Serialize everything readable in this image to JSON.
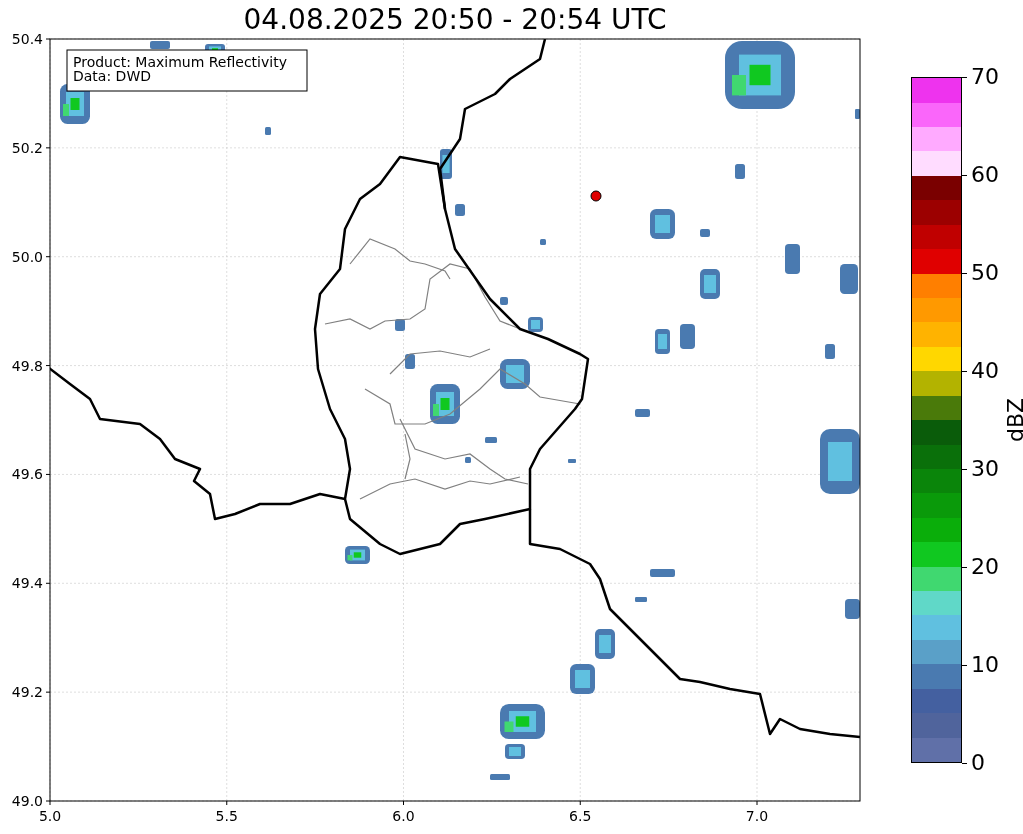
{
  "title": "04.08.2025 20:50 - 20:54 UTC",
  "legend": {
    "lines": [
      "Product: Maximum Reflectivity",
      "Data: DWD"
    ]
  },
  "x_ticks": [
    "5.0",
    "5.5",
    "6.0",
    "6.5",
    "7.0"
  ],
  "y_ticks": [
    "50.4",
    "50.2",
    "50.0",
    "49.8",
    "49.6",
    "49.4",
    "49.2",
    "49.0"
  ],
  "colorbar": {
    "label": "dBZ",
    "ticks": [
      "70",
      "60",
      "50",
      "40",
      "30",
      "20",
      "10",
      "0"
    ],
    "bins": [
      {
        "color": "#6070a8"
      },
      {
        "color": "#50649c"
      },
      {
        "color": "#4460a0"
      },
      {
        "color": "#4a7ab0"
      },
      {
        "color": "#5aa0c8"
      },
      {
        "color": "#60c0e0"
      },
      {
        "color": "#60d8c8"
      },
      {
        "color": "#40d870"
      },
      {
        "color": "#10c820"
      },
      {
        "color": "#0aae0a"
      },
      {
        "color": "#0a9a0a"
      },
      {
        "color": "#0a850a"
      },
      {
        "color": "#0a700a"
      },
      {
        "color": "#0a5c0a"
      },
      {
        "color": "#4a7a0a"
      },
      {
        "color": "#b3b300"
      },
      {
        "color": "#ffd700"
      },
      {
        "color": "#ffb300"
      },
      {
        "color": "#ff9900"
      },
      {
        "color": "#ff7f00"
      },
      {
        "color": "#e00000"
      },
      {
        "color": "#c00000"
      },
      {
        "color": "#9c0000"
      },
      {
        "color": "#7a0000"
      },
      {
        "color": "#ffdcff"
      },
      {
        "color": "#ffaaff"
      },
      {
        "color": "#fa66fa"
      },
      {
        "color": "#ee33ee"
      }
    ]
  }
}
